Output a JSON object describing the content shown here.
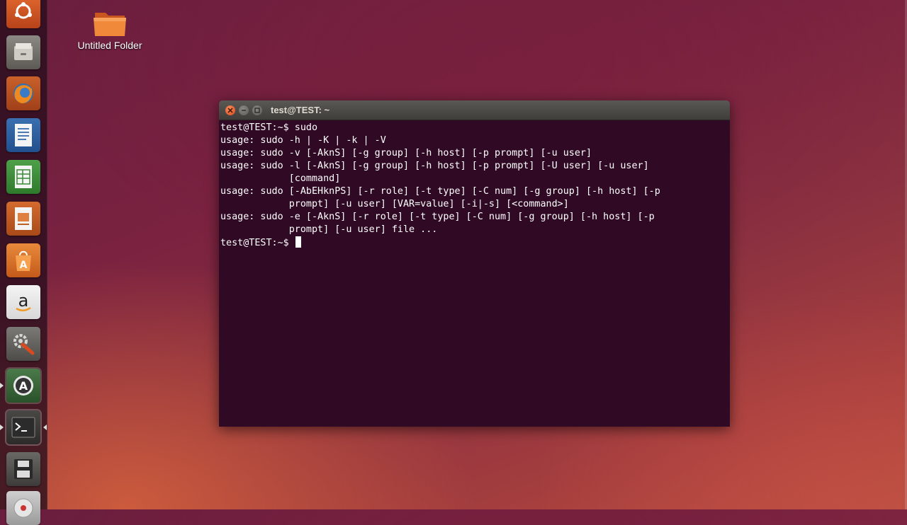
{
  "desktop": {
    "folder_label": "Untitled Folder"
  },
  "launcher": {
    "items": [
      {
        "name": "ubuntu-dash-icon"
      },
      {
        "name": "files-icon"
      },
      {
        "name": "firefox-icon"
      },
      {
        "name": "libreoffice-writer-icon"
      },
      {
        "name": "libreoffice-calc-icon"
      },
      {
        "name": "libreoffice-impress-icon"
      },
      {
        "name": "ubuntu-software-center-icon"
      },
      {
        "name": "amazon-icon"
      },
      {
        "name": "system-settings-icon"
      },
      {
        "name": "software-updater-icon"
      },
      {
        "name": "terminal-icon"
      },
      {
        "name": "save-disk-icon"
      },
      {
        "name": "dvd-icon"
      }
    ],
    "amazon_glyph": "a"
  },
  "terminal": {
    "title": "test@TEST: ~",
    "lines": [
      "test@TEST:~$ sudo",
      "usage: sudo -h | -K | -k | -V",
      "usage: sudo -v [-AknS] [-g group] [-h host] [-p prompt] [-u user]",
      "usage: sudo -l [-AknS] [-g group] [-h host] [-p prompt] [-U user] [-u user]",
      "            [command]",
      "usage: sudo [-AbEHknPS] [-r role] [-t type] [-C num] [-g group] [-h host] [-p",
      "            prompt] [-u user] [VAR=value] [-i|-s] [<command>]",
      "usage: sudo -e [-AknS] [-r role] [-t type] [-C num] [-g group] [-h host] [-p",
      "            prompt] [-u user] file ..."
    ],
    "prompt": "test@TEST:~$ "
  },
  "colors": {
    "terminal_bg": "#300a24",
    "close_button": "#e05a28"
  }
}
